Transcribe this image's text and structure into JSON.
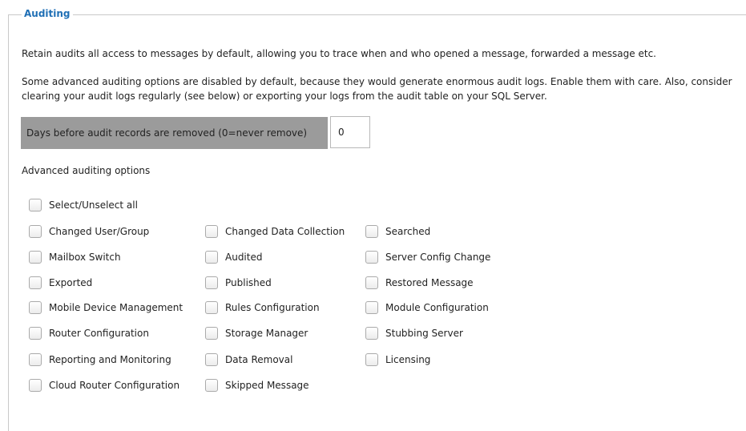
{
  "section": {
    "legend": "Auditing",
    "paragraph1": "Retain audits all access to messages by default, allowing you to trace when and who opened a message, forwarded a message etc.",
    "paragraph2": "Some advanced auditing options are disabled by default, because they would generate enormous audit logs. Enable them with care. Also, consider clearing your audit logs regularly (see below) or exporting your logs from the audit table on your SQL Server."
  },
  "retention": {
    "label": "Days before audit records are removed (0=never remove)",
    "value": "0"
  },
  "advanced": {
    "title": "Advanced auditing options",
    "select_all": {
      "label": "Select/Unselect all",
      "checked": false
    },
    "options": [
      {
        "label": "Changed User/Group",
        "checked": false
      },
      {
        "label": "Changed Data Collection",
        "checked": false
      },
      {
        "label": "Searched",
        "checked": false
      },
      {
        "label": "Mailbox Switch",
        "checked": false
      },
      {
        "label": "Audited",
        "checked": false
      },
      {
        "label": "Server Config Change",
        "checked": false
      },
      {
        "label": "Exported",
        "checked": false
      },
      {
        "label": "Published",
        "checked": false
      },
      {
        "label": "Restored Message",
        "checked": false
      },
      {
        "label": "Mobile Device Management",
        "checked": false
      },
      {
        "label": "Rules Configuration",
        "checked": false
      },
      {
        "label": "Module Configuration",
        "checked": false
      },
      {
        "label": "Router Configuration",
        "checked": false
      },
      {
        "label": "Storage Manager",
        "checked": false
      },
      {
        "label": "Stubbing Server",
        "checked": false
      },
      {
        "label": "Reporting and Monitoring",
        "checked": false
      },
      {
        "label": "Data Removal",
        "checked": false
      },
      {
        "label": "Licensing",
        "checked": false
      },
      {
        "label": "Cloud Router Configuration",
        "checked": false
      },
      {
        "label": "Skipped Message",
        "checked": false
      }
    ]
  },
  "colors": {
    "legend": "#1f6fb5",
    "label_background": "#9b9b9b",
    "border": "#c9c9c9"
  }
}
